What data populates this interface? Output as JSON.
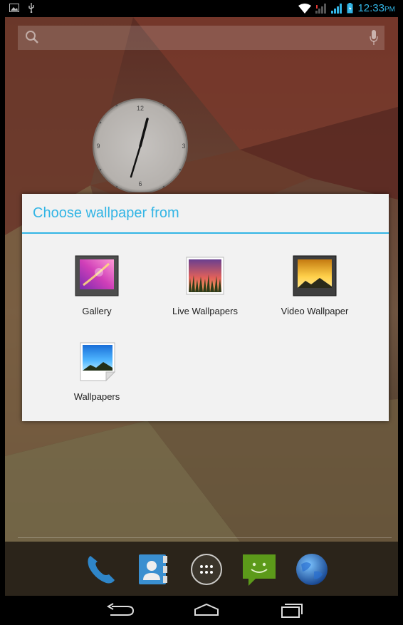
{
  "status_bar": {
    "time": "12:33",
    "ampm": "PM",
    "icons": [
      "picture-icon",
      "usb-icon",
      "wifi-icon",
      "signal-weak-icon",
      "signal-icon",
      "battery-icon"
    ]
  },
  "search": {
    "icons": [
      "search-icon",
      "mic-icon"
    ]
  },
  "clock_widget": {
    "numerals": [
      "12",
      "3",
      "6",
      "9"
    ]
  },
  "dialog": {
    "title": "Choose wallpaper from",
    "options": [
      {
        "label": "Gallery",
        "icon": "gallery-icon"
      },
      {
        "label": "Live Wallpapers",
        "icon": "live-wallpapers-icon"
      },
      {
        "label": "Video Wallpaper",
        "icon": "video-wallpaper-icon"
      },
      {
        "label": "Wallpapers",
        "icon": "wallpapers-icon"
      }
    ]
  },
  "dock": {
    "items": [
      "phone-icon",
      "contacts-icon",
      "all-apps-icon",
      "messaging-icon",
      "browser-icon"
    ]
  },
  "nav": {
    "items": [
      "back-icon",
      "home-icon",
      "recents-icon"
    ]
  },
  "colors": {
    "accent": "#33b5e5",
    "dialog_bg": "#f2f2f2"
  }
}
